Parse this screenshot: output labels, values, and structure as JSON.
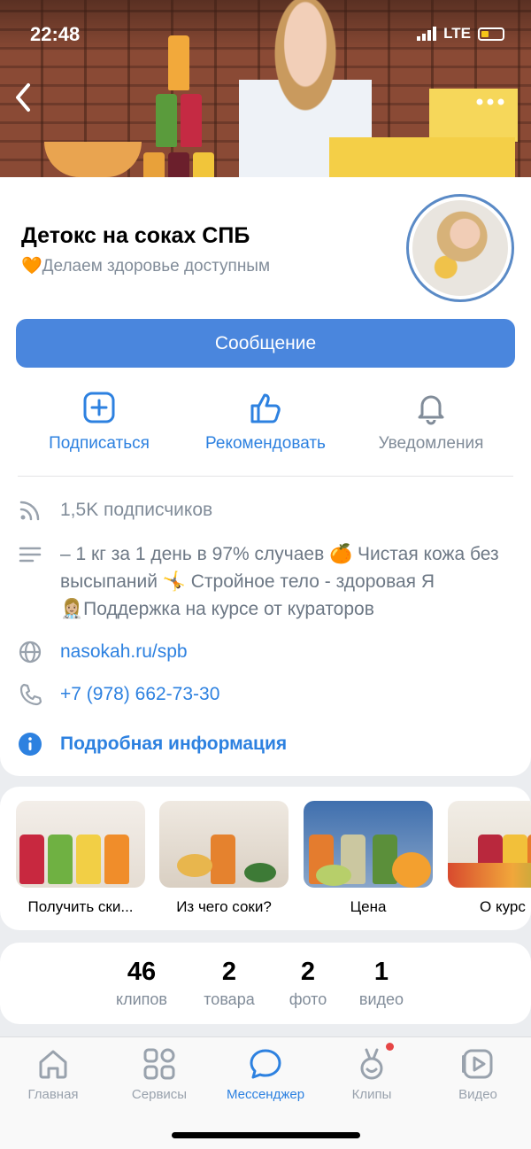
{
  "status_bar": {
    "time": "22:48",
    "network": "LTE"
  },
  "profile": {
    "name": "Детокс на соках СПБ",
    "status_emoji": "🧡",
    "status_text": "Делаем здоровье доступным",
    "message_button": "Сообщение"
  },
  "actions": [
    {
      "label": "Подписаться",
      "icon": "plus-square-icon"
    },
    {
      "label": "Рекомендовать",
      "icon": "thumbs-up-icon"
    },
    {
      "label": "Уведомления",
      "icon": "bell-icon"
    }
  ],
  "info": {
    "followers": "1,5K подписчиков",
    "description": "– 1 кг за 1 день в 97% случаев 🍊 Чистая кожа без высыпаний 🤸 Стройное тело - здоровая Я 👩🏼‍⚕️Поддержка на курсе от кураторов",
    "website": "nasokah.ru/spb",
    "phone": "+7 (978) 662-73-30",
    "more_info": "Подробная информация"
  },
  "stories": [
    {
      "caption": "Получить ски..."
    },
    {
      "caption": "Из чего соки?"
    },
    {
      "caption": "Цена"
    },
    {
      "caption": "О курс"
    }
  ],
  "counters": [
    {
      "value": "46",
      "label": "клипов"
    },
    {
      "value": "2",
      "label": "товара"
    },
    {
      "value": "2",
      "label": "фото"
    },
    {
      "value": "1",
      "label": "видео"
    }
  ],
  "tabbar": [
    {
      "label": "Главная",
      "icon": "home-icon"
    },
    {
      "label": "Сервисы",
      "icon": "grid-icon"
    },
    {
      "label": "Мессенджер",
      "icon": "chat-icon",
      "active": true
    },
    {
      "label": "Клипы",
      "icon": "clips-icon",
      "badge": true
    },
    {
      "label": "Видео",
      "icon": "video-icon"
    }
  ],
  "colors": {
    "accent": "#2d81e0",
    "button": "#4a86dd",
    "muted": "#818c99",
    "badge": "#e64646"
  }
}
